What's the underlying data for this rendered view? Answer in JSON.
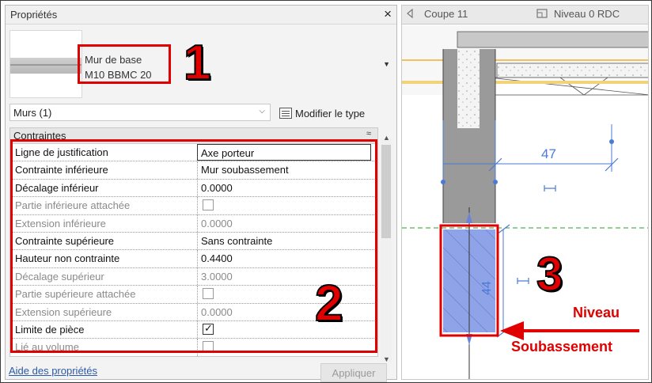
{
  "properties_panel": {
    "title": "Propriétés",
    "close_glyph": "×",
    "type_selector": {
      "family": "Mur de base",
      "type": "M10 BBMC 20",
      "dropdown_glyph": "▼"
    },
    "instance_filter": {
      "value": "Murs (1)",
      "chevron": "⌵"
    },
    "modify_type_label": "Modifier le type",
    "section": {
      "name": "Contraintes",
      "collapse_glyph": "≈"
    },
    "rows": [
      {
        "label": "Ligne de justification",
        "value": "Axe porteur",
        "enabled": true,
        "kind": "text"
      },
      {
        "label": "Contrainte inférieure",
        "value": "Mur soubassement",
        "enabled": true,
        "kind": "text"
      },
      {
        "label": "Décalage inférieur",
        "value": "0.0000",
        "enabled": true,
        "kind": "text"
      },
      {
        "label": "Partie inférieure attachée",
        "value": "",
        "enabled": false,
        "kind": "checkbox",
        "checked": false
      },
      {
        "label": "Extension inférieure",
        "value": "0.0000",
        "enabled": false,
        "kind": "text"
      },
      {
        "label": "Contrainte supérieure",
        "value": "Sans contrainte",
        "enabled": true,
        "kind": "text"
      },
      {
        "label": "Hauteur non contrainte",
        "value": "0.4400",
        "enabled": true,
        "kind": "text"
      },
      {
        "label": "Décalage supérieur",
        "value": "3.0000",
        "enabled": false,
        "kind": "text"
      },
      {
        "label": "Partie supérieure attachée",
        "value": "",
        "enabled": false,
        "kind": "checkbox",
        "checked": false
      },
      {
        "label": "Extension supérieure",
        "value": "0.0000",
        "enabled": false,
        "kind": "text"
      },
      {
        "label": "Limite de pièce",
        "value": "",
        "enabled": true,
        "kind": "checkbox",
        "checked": true
      },
      {
        "label": "Lié au volume",
        "value": "",
        "enabled": false,
        "kind": "checkbox",
        "checked": false
      }
    ],
    "help_link": "Aide des propriétés",
    "apply_button": "Appliquer"
  },
  "view_tabs": {
    "section_tab": "Coupe 11",
    "plan_tab": "Niveau 0 RDC"
  },
  "drawing": {
    "dimension_top": "47",
    "dimension_wall": "44"
  },
  "annotations": {
    "marker_1": "1",
    "marker_2": "2",
    "marker_3": "3",
    "label_niveau": "Niveau",
    "label_soubassement": "Soubassement"
  },
  "colors": {
    "highlight_red": "#e00000",
    "selected_wall_fill": "#8fa4e8",
    "dimension_blue": "#4a7ad6",
    "link_blue": "#2b5aa8"
  }
}
